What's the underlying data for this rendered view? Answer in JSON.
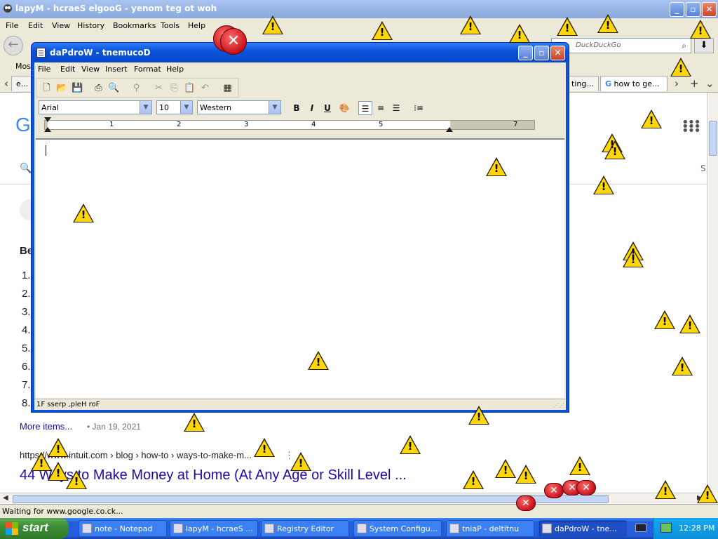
{
  "browser": {
    "title": "lapyM - hcraeS elgooG - yenom teg ot woh",
    "menu": [
      "File",
      "Edit",
      "View",
      "History",
      "Bookmarks",
      "Tools",
      "Help"
    ],
    "search_placeholder": "DuckDuckGo",
    "bookmarks_label": "Most",
    "tabs": [
      {
        "label": "e..."
      },
      {
        "label": "ting..."
      },
      {
        "label": "how to ge..."
      }
    ],
    "status": "Waiting for www.google.co.ck...",
    "window_buttons": {
      "min": "_",
      "max": "▫",
      "close": "✕"
    }
  },
  "google": {
    "logo_letter": "G",
    "section_heading": "Be",
    "list_numbers": [
      "1.",
      "2.",
      "3.",
      "4.",
      "5.",
      "6.",
      "7.",
      "8."
    ],
    "more_items": "More items...",
    "date": "• Jan 19, 2021",
    "url": "https://www.intuit.com › blog › how-to › ways-to-make-m...",
    "url_dots": "⋮",
    "headline": "44 Ways to Make Money at Home (At Any Age or Skill Level ...",
    "side_letter": "S"
  },
  "wordpad": {
    "title": "daPdroW - tnemucoD",
    "menu": [
      "File",
      "Edit",
      "View",
      "Insert",
      "Format",
      "Help"
    ],
    "font": "Arial",
    "size": "10",
    "script": "Western",
    "bold": "B",
    "italic": "I",
    "underline": "U",
    "ruler_numbers": [
      "1",
      "2",
      "3",
      "4",
      "5",
      "7"
    ],
    "status": "1F sserp ,pleH roF"
  },
  "taskbar": {
    "start": "start",
    "tasks": [
      "note - Notepad",
      "lapyM - hcraeS ...",
      "Registry Editor",
      "System Configu...",
      "tniaP - deltitnu",
      "daPdroW - tne..."
    ],
    "clock": "12:28 PM"
  },
  "popups": {
    "warning_glyph": "!",
    "error_glyph": "✕"
  },
  "colors": {
    "xp_blue": "#0a52d8",
    "start_green": "#3c8e34",
    "warning_yellow": "#ffd60a",
    "error_red": "#c9121a",
    "link_blue": "#1a0dab"
  }
}
